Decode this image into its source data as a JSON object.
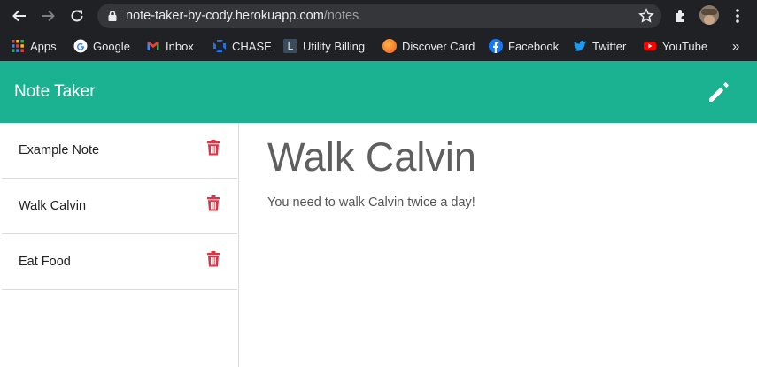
{
  "browser": {
    "url_host": "note-taker-by-cody.herokuapp.com",
    "url_path": "/notes",
    "bookmarks": [
      {
        "label": "Apps",
        "icon": "apps-grid-icon"
      },
      {
        "label": "Google",
        "icon": "google-icon"
      },
      {
        "label": "Inbox",
        "icon": "gmail-icon"
      },
      {
        "label": "CHASE",
        "icon": "chase-icon"
      },
      {
        "label": "Utility Billing",
        "icon": "utility-billing-icon"
      },
      {
        "label": "Discover Card",
        "icon": "discover-icon"
      },
      {
        "label": "Facebook",
        "icon": "facebook-icon"
      },
      {
        "label": "Twitter",
        "icon": "twitter-icon"
      },
      {
        "label": "YouTube",
        "icon": "youtube-icon"
      }
    ],
    "overflow_label": "»"
  },
  "app": {
    "title": "Note Taker",
    "accent_color": "#1ab291",
    "delete_color": "#dc3545"
  },
  "notes": [
    {
      "title": "Example Note"
    },
    {
      "title": "Walk Calvin"
    },
    {
      "title": "Eat Food"
    }
  ],
  "active_note": {
    "title": "Walk Calvin",
    "text": "You need to walk Calvin twice a day!"
  }
}
